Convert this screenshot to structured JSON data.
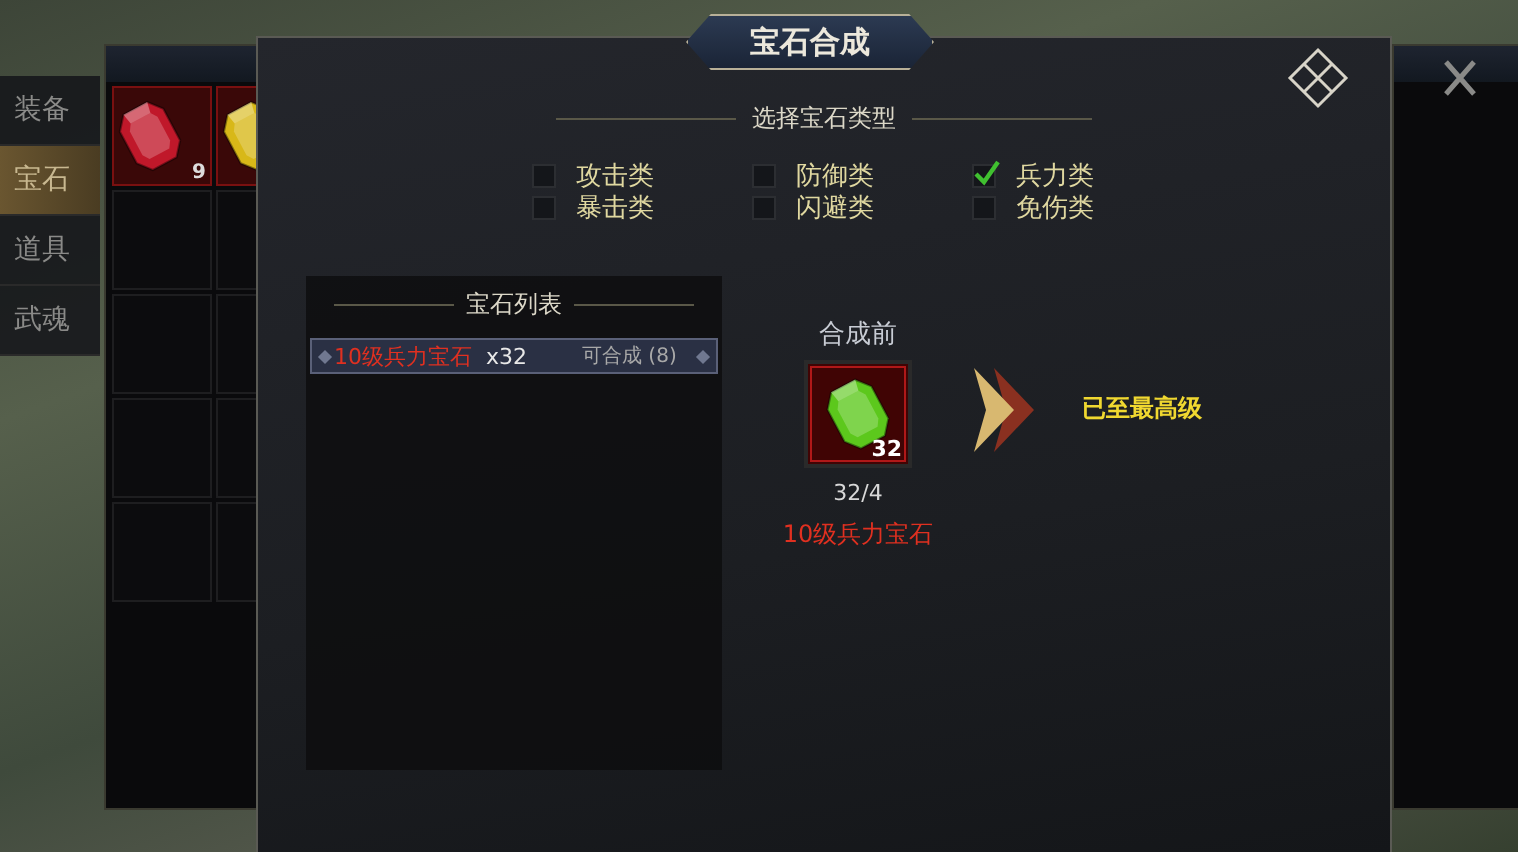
{
  "side_tabs": [
    {
      "label": "装备",
      "selected": false
    },
    {
      "label": "宝石",
      "selected": true
    },
    {
      "label": "道具",
      "selected": false
    },
    {
      "label": "武魂",
      "selected": false
    }
  ],
  "inventory": [
    {
      "kind": "gem",
      "color": "#c0182a",
      "count": "9"
    },
    {
      "kind": "gem",
      "color": "#d8b818"
    },
    {
      "kind": "empty"
    },
    {
      "kind": "empty"
    },
    {
      "kind": "empty"
    },
    {
      "kind": "empty"
    },
    {
      "kind": "empty"
    },
    {
      "kind": "empty"
    },
    {
      "kind": "empty"
    },
    {
      "kind": "empty"
    }
  ],
  "dialog": {
    "title": "宝石合成",
    "type_heading": "选择宝石类型",
    "types": [
      {
        "label": "攻击类",
        "checked": false
      },
      {
        "label": "防御类",
        "checked": false
      },
      {
        "label": "兵力类",
        "checked": true
      },
      {
        "label": "暴击类",
        "checked": false
      },
      {
        "label": "闪避类",
        "checked": false
      },
      {
        "label": "免伤类",
        "checked": false
      }
    ],
    "list_heading": "宝石列表",
    "gem_list": [
      {
        "name": "10级兵力宝石",
        "quantity": "x32",
        "status": "可合成 (8)",
        "selected": true
      }
    ],
    "before_label": "合成前",
    "before_gem": {
      "color": "#5cc81c",
      "count": "32",
      "ratio": "32/4",
      "name": "10级兵力宝石"
    },
    "result_text": "已至最高级"
  }
}
